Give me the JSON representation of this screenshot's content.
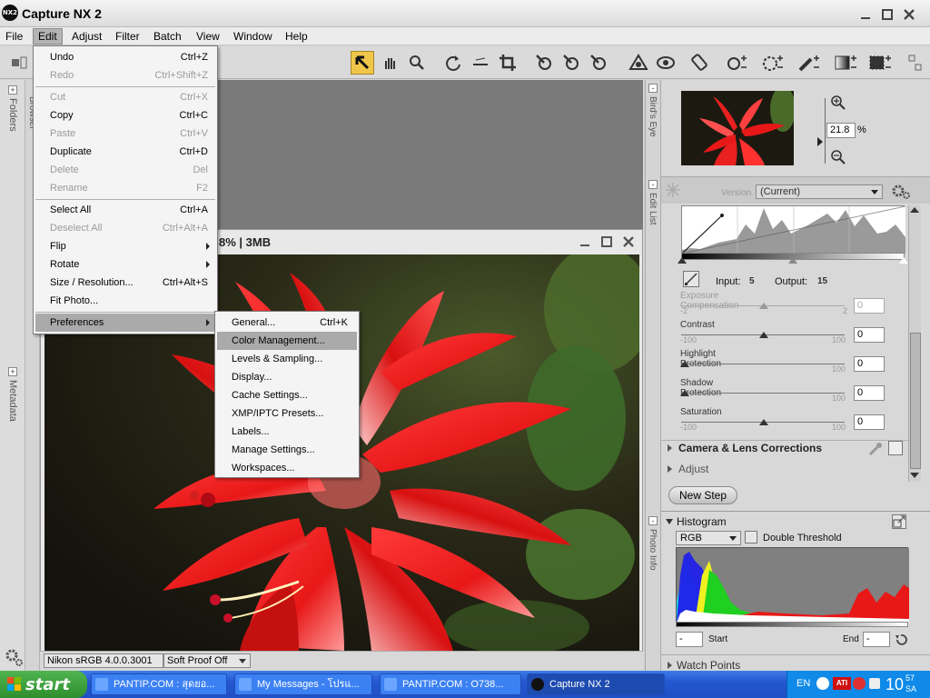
{
  "window": {
    "title": "Capture NX 2",
    "logo": "NX2"
  },
  "menubar": {
    "items": [
      "File",
      "Edit",
      "Adjust",
      "Filter",
      "Batch",
      "View",
      "Window",
      "Help"
    ]
  },
  "edit_menu": {
    "items": [
      {
        "label": "Undo",
        "shortcut": "Ctrl+Z"
      },
      {
        "label": "Redo",
        "shortcut": "Ctrl+Shift+Z"
      },
      {
        "label": "Cut",
        "shortcut": "Ctrl+X"
      },
      {
        "label": "Copy",
        "shortcut": "Ctrl+C"
      },
      {
        "label": "Paste",
        "shortcut": "Ctrl+V"
      },
      {
        "label": "Duplicate",
        "shortcut": "Ctrl+D"
      },
      {
        "label": "Delete",
        "shortcut": "Del"
      },
      {
        "label": "Rename",
        "shortcut": "F2"
      },
      {
        "label": "Select All",
        "shortcut": "Ctrl+A"
      },
      {
        "label": "Deselect All",
        "shortcut": "Ctrl+Alt+A"
      },
      {
        "label": "Flip",
        "shortcut": ""
      },
      {
        "label": "Rotate",
        "shortcut": ""
      },
      {
        "label": "Size / Resolution...",
        "shortcut": "Ctrl+Alt+S"
      },
      {
        "label": "Fit Photo...",
        "shortcut": ""
      },
      {
        "label": "Preferences",
        "shortcut": ""
      }
    ]
  },
  "preferences_menu": {
    "items": [
      {
        "label": "General...",
        "shortcut": "Ctrl+K"
      },
      {
        "label": "Color Management...",
        "shortcut": ""
      },
      {
        "label": "Levels & Sampling...",
        "shortcut": ""
      },
      {
        "label": "Display...",
        "shortcut": ""
      },
      {
        "label": "Cache Settings...",
        "shortcut": ""
      },
      {
        "label": "XMP/IPTC Presets...",
        "shortcut": ""
      },
      {
        "label": "Labels...",
        "shortcut": ""
      },
      {
        "label": "Manage Settings...",
        "shortcut": ""
      },
      {
        "label": "Workspaces...",
        "shortcut": ""
      }
    ]
  },
  "left_panels": {
    "folders": "Folders",
    "browser": "Browser",
    "metadata": "Metadata"
  },
  "image_window": {
    "title_visible": "8% | 3MB"
  },
  "statusbar": {
    "profile": "Nikon sRGB 4.0.0.3001",
    "soft_proof": "Soft Proof Off"
  },
  "birds_eye": {
    "tab": "Bird's Eye",
    "zoom_value": "21.8",
    "zoom_unit": "%"
  },
  "edit_list": {
    "tab": "Edit List",
    "version_label": "Version",
    "version_value": "(Current)",
    "input_label": "Input:",
    "input_value": "5",
    "output_label": "Output:",
    "output_value": "15",
    "sliders": [
      {
        "label": "Exposure Compensation",
        "min": "-2",
        "max": "2",
        "value": "0",
        "position": 0.5,
        "enabled": false
      },
      {
        "label": "Contrast",
        "min": "-100",
        "max": "100",
        "value": "0",
        "position": 0.5,
        "enabled": true
      },
      {
        "label": "Highlight Protection",
        "min": "",
        "max": "100",
        "value": "0",
        "position": 0.0,
        "enabled": true
      },
      {
        "label": "Shadow Protection",
        "min": "",
        "max": "100",
        "value": "0",
        "position": 0.0,
        "enabled": true
      },
      {
        "label": "Saturation",
        "min": "-100",
        "max": "100",
        "value": "0",
        "position": 0.5,
        "enabled": true
      }
    ],
    "camera_lens": "Camera & Lens Corrections",
    "adjust": "Adjust",
    "new_step": "New Step"
  },
  "photo_info": {
    "tab": "Photo Info",
    "histogram_title": "Histogram",
    "channel": "RGB",
    "double_threshold": "Double Threshold",
    "start_label": "Start",
    "start_value": "-",
    "end_label": "End",
    "end_value": "-",
    "watch_points": "Watch Points"
  },
  "taskbar": {
    "start": "start",
    "tasks": [
      {
        "label": "PANTIP.COM : สุดยอ...",
        "active": false
      },
      {
        "label": "My Messages - โปรแ...",
        "active": false
      },
      {
        "label": "PANTIP.COM : O738...",
        "active": false
      },
      {
        "label": "Capture NX 2",
        "active": true
      }
    ],
    "lang": "EN",
    "clock_hour": "10",
    "clock_min": "57",
    "clock_ampm": "SA"
  },
  "colors": {
    "menu_highlight": "#aaaaaa",
    "tool_active": "#f0c64a",
    "taskbar": "#2457d0",
    "start_green": "#3aa23a"
  }
}
